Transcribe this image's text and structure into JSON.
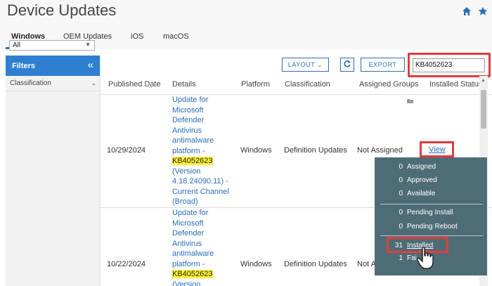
{
  "header": {
    "title": "Device Updates",
    "icons": [
      "home-icon",
      "star-icon"
    ],
    "accent": "#2a6ebb"
  },
  "tabs": [
    {
      "label": "Windows",
      "active": true
    },
    {
      "label": "OEM Updates"
    },
    {
      "label": "iOS"
    },
    {
      "label": "macOS"
    }
  ],
  "filters": {
    "title": "Filters",
    "collapse_symbol": "«",
    "classification_label": "Classification",
    "classification_value": "All"
  },
  "toolbar": {
    "layout_label": "LAYOUT",
    "export_label": "EXPORT",
    "search_value": "KB4052623",
    "refresh_icon": "refresh-icon"
  },
  "table": {
    "columns": [
      "Published Date",
      "Details",
      "Platform",
      "Classification",
      "Assigned Groups",
      "Installed Status"
    ],
    "rows": [
      {
        "published_date": "10/29/2024",
        "details_lines": [
          "Update for",
          "Microsoft",
          "Defender",
          "Antivirus",
          "antimalware",
          "platform -",
          "KB4052623",
          "(Version",
          "4.18.24090.11) -",
          "Current Channel",
          "(Broad)"
        ],
        "platform": "Windows",
        "classification": "Definition Updates",
        "assigned_groups": "Not Assigned",
        "installed_status": "View"
      },
      {
        "published_date": "10/22/2024",
        "details_lines": [
          "Update for",
          "Microsoft",
          "Defender",
          "Antivirus",
          "antimalware",
          "platform -",
          "KB4052623",
          "(Version"
        ],
        "platform": "Windows",
        "classification": "Definition Updates",
        "assigned_groups": "Not A"
      }
    ]
  },
  "status_popup": {
    "items": [
      {
        "count": "0",
        "label": "Assigned"
      },
      {
        "count": "0",
        "label": "Approved"
      },
      {
        "count": "0",
        "label": "Available"
      },
      {
        "count": "0",
        "label": "Pending Install"
      },
      {
        "count": "0",
        "label": "Pending Reboot"
      },
      {
        "count": "31",
        "label": "Installed"
      },
      {
        "count": "1",
        "label": "Fai"
      }
    ],
    "background": "#4e6c76"
  },
  "highlight_color": "#e23c3c"
}
